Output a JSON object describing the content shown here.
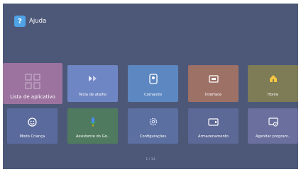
{
  "header": {
    "title": "Ajuda",
    "icon": "question-icon"
  },
  "tiles": [
    {
      "label": "Lista de aplicativo",
      "icon": "apps-grid-icon",
      "color": "#9c739f"
    },
    {
      "label": "Tecla de atalho",
      "icon": "shortcut-key-icon",
      "color": "#6f86c4"
    },
    {
      "label": "Comando",
      "icon": "remote-command-icon",
      "color": "#5d87c0"
    },
    {
      "label": "Interface",
      "icon": "interface-icon",
      "color": "#9e7166"
    },
    {
      "label": "Home",
      "icon": "home-icon",
      "color": "#7d7c56"
    },
    {
      "label": "Modo Criança",
      "icon": "child-mode-icon",
      "color": "#5a6a9c"
    },
    {
      "label": "Assistente do Go..",
      "icon": "google-assistant-icon",
      "color": "#4f7a5f"
    },
    {
      "label": "Configurações",
      "icon": "settings-icon",
      "color": "#5b6fa0"
    },
    {
      "label": "Armazenamento",
      "icon": "storage-icon",
      "color": "#5c6896"
    },
    {
      "label": "Agendar program..",
      "icon": "schedule-program-icon",
      "color": "#6a6f9e"
    }
  ],
  "pager": {
    "text": "1 / 13"
  }
}
